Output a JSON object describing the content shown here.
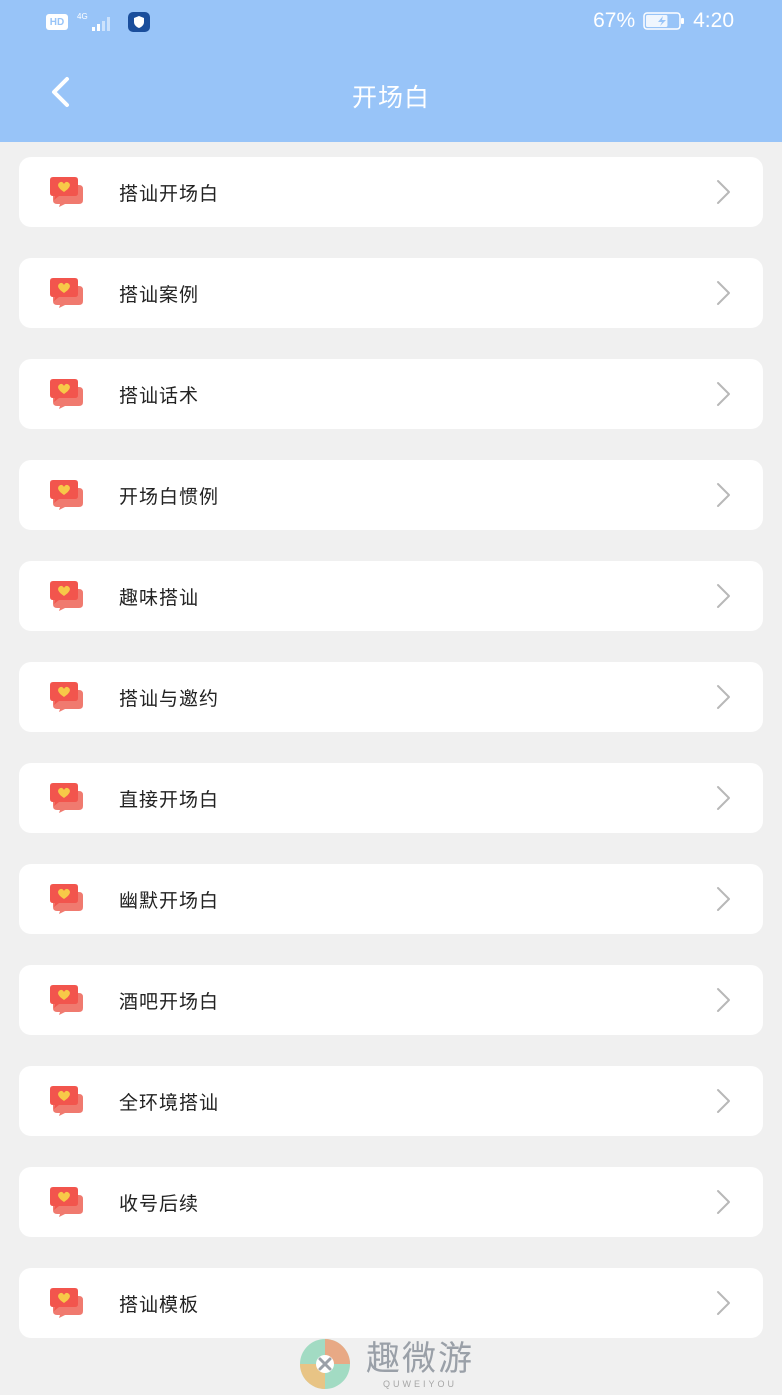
{
  "status_bar": {
    "hd_label": "HD",
    "network_label": "4G",
    "battery_percent": "67%",
    "battery_level": 0.67,
    "time": "4:20"
  },
  "nav": {
    "title": "开场白",
    "back_icon": "chevron-left-icon"
  },
  "list": {
    "item_icon": "chat-heart-icon",
    "item_chevron": "chevron-right-icon",
    "items": [
      {
        "label": "搭讪开场白"
      },
      {
        "label": "搭讪案例"
      },
      {
        "label": "搭讪话术"
      },
      {
        "label": "开场白惯例"
      },
      {
        "label": "趣味搭讪"
      },
      {
        "label": "搭讪与邀约"
      },
      {
        "label": "直接开场白"
      },
      {
        "label": "幽默开场白"
      },
      {
        "label": "酒吧开场白"
      },
      {
        "label": "全环境搭讪"
      },
      {
        "label": "收号后续"
      },
      {
        "label": "搭讪模板"
      }
    ]
  },
  "watermark": {
    "title": "趣微游",
    "subtitle": "QUWEIYOU"
  },
  "colors": {
    "header": "#98c4f8",
    "background": "#f0f0f0",
    "icon_red": "#f2554d",
    "icon_yellow": "#f7c948"
  }
}
